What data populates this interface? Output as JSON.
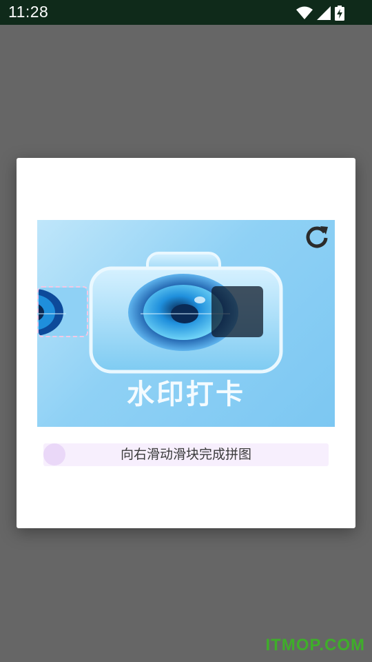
{
  "status_bar": {
    "time": "11:28",
    "icons": [
      "wifi-icon",
      "signal-icon",
      "battery-charging-icon"
    ]
  },
  "captcha": {
    "image_caption": "水印打卡",
    "refresh_icon": "refresh-icon",
    "slider_hint": "向右滑动滑块完成拼图"
  },
  "watermark": {
    "text": "ITMOP.COM"
  },
  "colors": {
    "status_bar_bg": "#0f2a1a",
    "overlay": "#666666",
    "slider_track": "#f7effd",
    "slider_thumb": "#ead8f8",
    "watermark": "#3fae2a"
  }
}
